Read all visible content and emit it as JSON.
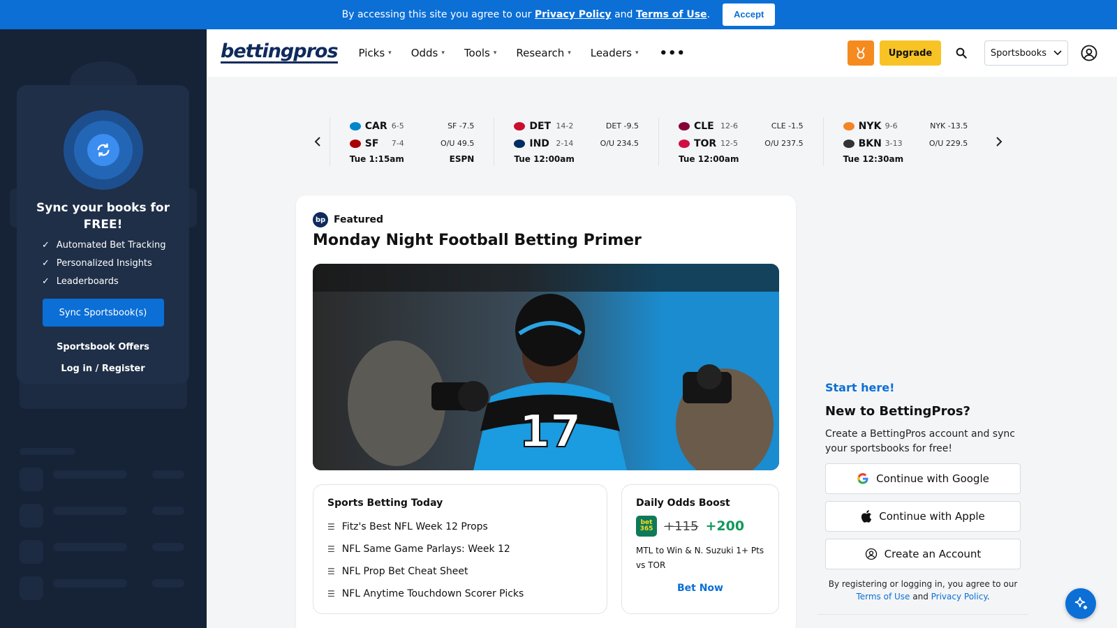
{
  "banner": {
    "text_before": "By accessing this site you agree to our",
    "privacy_link": "Privacy Policy",
    "and": "and",
    "terms_link": "Terms of Use",
    "period": ".",
    "accept_label": "Accept"
  },
  "sidebar": {
    "sync_title": "Sync your books for FREE!",
    "features": [
      "Automated Bet Tracking",
      "Personalized Insights",
      "Leaderboards"
    ],
    "sync_button": "Sync Sportsbook(s)",
    "offers_link": "Sportsbook Offers",
    "login_link": "Log in / Register"
  },
  "header": {
    "logo": "bettingpros",
    "nav": [
      "Picks",
      "Odds",
      "Tools",
      "Research",
      "Leaders"
    ],
    "more": "•••",
    "upgrade_label": "Upgrade",
    "sportsbooks_label": "Sportsbooks"
  },
  "scoreboard": {
    "games": [
      {
        "away": "CAR",
        "away_rec": "6-5",
        "home": "SF",
        "home_rec": "7-4",
        "line1": "SF -7.5",
        "line2": "O/U 49.5",
        "time": "Tue 1:15am",
        "network": "ESPN",
        "away_color": "#0085ca",
        "home_color": "#aa0000"
      },
      {
        "away": "DET",
        "away_rec": "14-2",
        "home": "IND",
        "home_rec": "2-14",
        "line1": "DET -9.5",
        "line2": "O/U 234.5",
        "time": "Tue 12:00am",
        "network": "",
        "away_color": "#c8102e",
        "home_color": "#002d62"
      },
      {
        "away": "CLE",
        "away_rec": "12-6",
        "home": "TOR",
        "home_rec": "12-5",
        "line1": "CLE -1.5",
        "line2": "O/U 237.5",
        "time": "Tue 12:00am",
        "network": "",
        "away_color": "#860038",
        "home_color": "#ce1141"
      },
      {
        "away": "NYK",
        "away_rec": "9-6",
        "home": "BKN",
        "home_rec": "3-13",
        "line1": "NYK -13.5",
        "line2": "O/U 229.5",
        "time": "Tue 12:30am",
        "network": "",
        "away_color": "#f58426",
        "home_color": "#333333"
      }
    ]
  },
  "featured": {
    "tag": "Featured",
    "title": "Monday Night Football Betting Primer",
    "jersey_number": "17"
  },
  "today": {
    "heading": "Sports Betting Today",
    "links": [
      "Fitz's Best NFL Week 12 Props",
      "NFL Same Game Parlays: Week 12",
      "NFL Prop Bet Cheat Sheet",
      "NFL Anytime Touchdown Scorer Picks"
    ]
  },
  "boost": {
    "heading": "Daily Odds Boost",
    "book": "bet 365",
    "old_odds": "+115",
    "new_odds": "+200",
    "description": "MTL to Win & N. Suzuki 1+ Pts vs TOR",
    "cta": "Bet Now"
  },
  "signup": {
    "start": "Start here!",
    "title": "New to BettingPros?",
    "desc": "Create a BettingPros account and sync your sportsbooks for free!",
    "google": "Continue with Google",
    "apple": "Continue with Apple",
    "create": "Create an Account",
    "legal_before": "By registering or logging in, you agree to our",
    "terms": "Terms of Use",
    "and": "and",
    "privacy": "Privacy Policy",
    "period": "."
  },
  "colors": {
    "brand_blue": "#0b6fd6",
    "navy": "#0f2a5c",
    "upgrade_yellow": "#f7c325",
    "medal_orange": "#f58a1f",
    "boost_green": "#13985b"
  }
}
